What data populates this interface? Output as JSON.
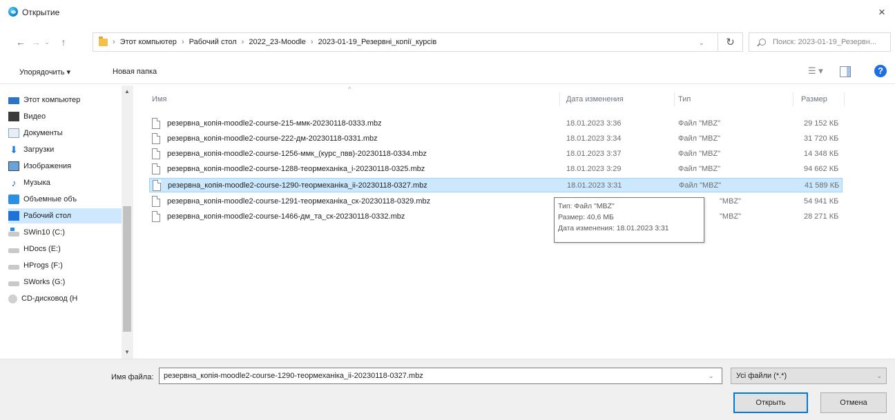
{
  "window": {
    "title": "Открытие",
    "close_glyph": "×"
  },
  "nav": {
    "back_glyph": "←",
    "forward_glyph": "→",
    "history_glyph": "⌄",
    "up_glyph": "↑"
  },
  "address": {
    "breadcrumbs": [
      "Этот компьютер",
      "Рабочий стол",
      "2022_23-Moodle",
      "2023-01-19_Резервні_копії_курсів"
    ],
    "separator": "›",
    "dropdown_glyph": "⌄",
    "refresh_glyph": "↻"
  },
  "search": {
    "placeholder": "Поиск: 2023-01-19_Резервн..."
  },
  "toolbar": {
    "organize_label": "Упорядочить ▾",
    "new_folder_label": "Новая папка",
    "view_glyph": "☰ ▾",
    "help_glyph": "?"
  },
  "sidebar": {
    "items": [
      {
        "label": "Этот компьютер",
        "icon": "pc-icon"
      },
      {
        "label": "Видео",
        "icon": "video-icon"
      },
      {
        "label": "Документы",
        "icon": "documents-icon"
      },
      {
        "label": "Загрузки",
        "icon": "downloads-icon"
      },
      {
        "label": "Изображения",
        "icon": "pictures-icon"
      },
      {
        "label": "Музыка",
        "icon": "music-icon"
      },
      {
        "label": "Объемные объ",
        "icon": "3d-objects-icon"
      },
      {
        "label": "Рабочий стол",
        "icon": "desktop-icon"
      },
      {
        "label": "SWin10 (C:)",
        "icon": "system-drive-icon"
      },
      {
        "label": "HDocs (E:)",
        "icon": "drive-icon"
      },
      {
        "label": "HProgs (F:)",
        "icon": "drive-icon"
      },
      {
        "label": "SWorks (G:)",
        "icon": "drive-icon"
      },
      {
        "label": "CD-дисковод (H",
        "icon": "cd-drive-icon"
      }
    ],
    "selected_index": 7,
    "scroll_up_glyph": "▲",
    "scroll_down_glyph": "▼"
  },
  "columns": {
    "name": "Имя",
    "date": "Дата изменения",
    "type": "Тип",
    "size": "Размер",
    "sort_glyph": "^"
  },
  "files": [
    {
      "name": "резервна_копія-moodle2-course-215-ммк-20230118-0333.mbz",
      "date": "18.01.2023 3:36",
      "type": "Файл \"MBZ\"",
      "size": "29 152 КБ"
    },
    {
      "name": "резервна_копія-moodle2-course-222-дм-20230118-0331.mbz",
      "date": "18.01.2023 3:34",
      "type": "Файл \"MBZ\"",
      "size": "31 720 КБ"
    },
    {
      "name": "резервна_копія-moodle2-course-1256-ммк_(курс_пвв)-20230118-0334.mbz",
      "date": "18.01.2023 3:37",
      "type": "Файл \"MBZ\"",
      "size": "14 348 КБ"
    },
    {
      "name": "резервна_копія-moodle2-course-1288-теормеханіка_i-20230118-0325.mbz",
      "date": "18.01.2023 3:29",
      "type": "Файл \"MBZ\"",
      "size": "94 662 КБ"
    },
    {
      "name": "резервна_копія-moodle2-course-1290-теормеханіка_ii-20230118-0327.mbz",
      "date": "18.01.2023 3:31",
      "type": "Файл \"MBZ\"",
      "size": "41 589 КБ"
    },
    {
      "name": "резервна_копія-moodle2-course-1291-теормеханіка_ск-20230118-0329.mbz",
      "date": "",
      "type": "\"MBZ\"",
      "size": "54 941 КБ"
    },
    {
      "name": "резервна_копія-moodle2-course-1466-дм_та_ск-20230118-0332.mbz",
      "date": "",
      "type": "\"MBZ\"",
      "size": "28 271 КБ"
    }
  ],
  "selected_file_index": 4,
  "tooltip": {
    "type_line": "Тип: Файл \"MBZ\"",
    "size_line": "Размер: 40,6 МБ",
    "date_line": "Дата изменения: 18.01.2023 3:31"
  },
  "footer": {
    "filename_label": "Имя файла:",
    "filename_value": "резервна_копія-moodle2-course-1290-теормеханіка_ii-20230118-0327.mbz",
    "filter_value": "Усі файли (*.*)",
    "dropdown_glyph": "⌄",
    "open_label": "Открыть",
    "cancel_label": "Отмена"
  },
  "colors": {
    "selection": "#cce8ff",
    "selection_border": "#99d1ff",
    "primary_button_border": "#0078d7",
    "help": "#1f6fe0"
  }
}
